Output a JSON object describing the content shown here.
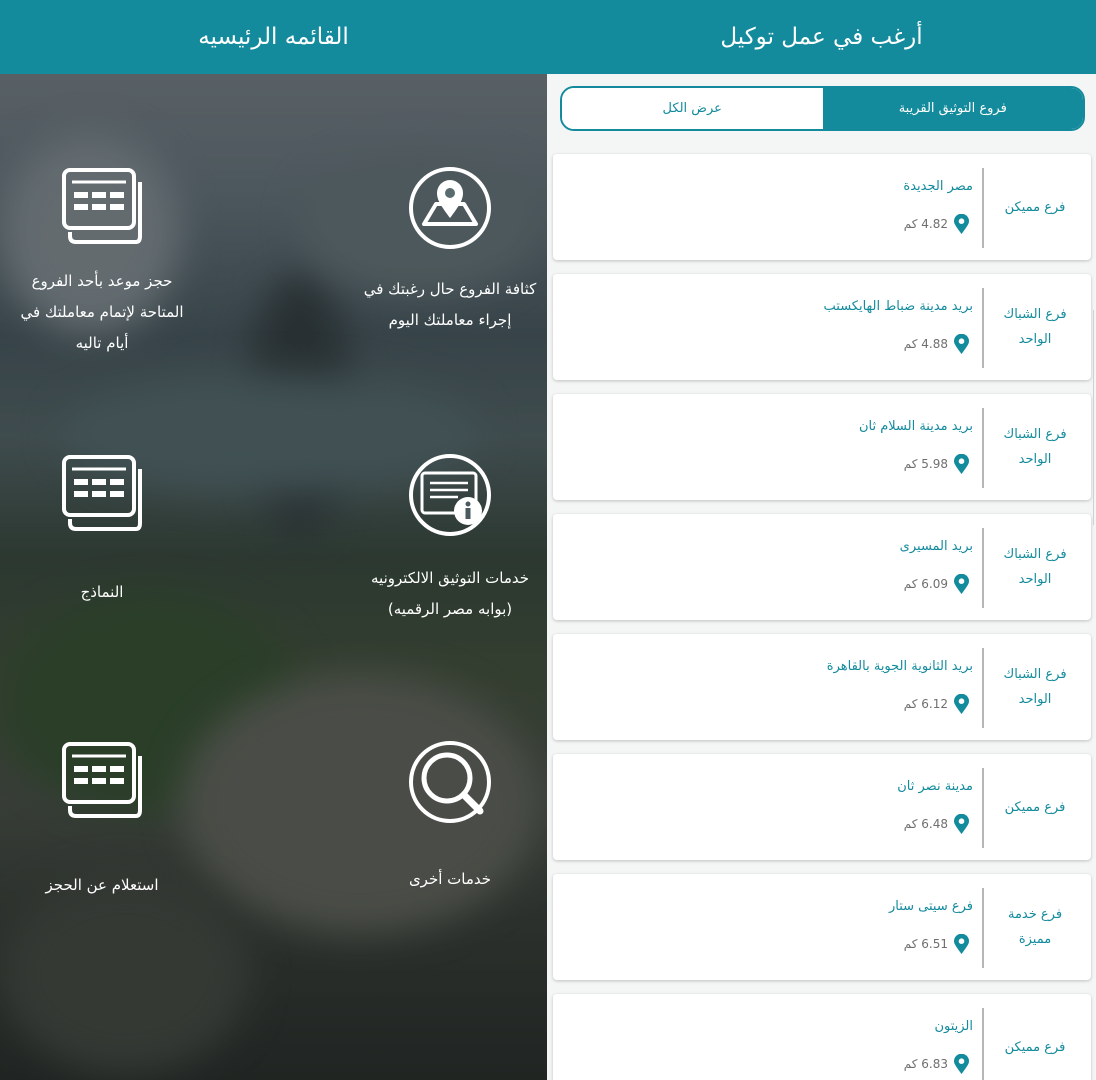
{
  "main_menu": {
    "title": "القائمه الرئيسيه",
    "items": [
      {
        "icon": "map-location-icon",
        "label_lines": [
          "كثافة الفروع حال رغبتك في",
          "إجراء معاملتك اليوم"
        ]
      },
      {
        "icon": "appointment-calendar-icon",
        "label_lines": [
          "حجز موعد بأحد الفروع",
          "المتاحة لإتمام معاملتك في",
          "أيام تاليه"
        ]
      },
      {
        "icon": "certificate-info-icon",
        "label_lines": [
          "خدمات التوثيق الالكترونيه",
          "(بوابه مصر الرقميه)"
        ]
      },
      {
        "icon": "forms-document-icon",
        "label_lines": [
          "النماذج"
        ]
      },
      {
        "icon": "search-icon",
        "label_lines": [
          "خدمات أخرى"
        ]
      },
      {
        "icon": "booking-inquiry-icon",
        "label_lines": [
          "استعلام عن الحجز"
        ]
      }
    ]
  },
  "delegation": {
    "title": "أرغب في عمل توكيل",
    "tabs": {
      "nearby": "فروع التوثيق القريبة",
      "all": "عرض الكل"
    },
    "active_tab": "nearby",
    "accent_color": "#138b9d",
    "branches": [
      {
        "type_lines": [
          "فرع مميكن"
        ],
        "name": "مصر الجديدة",
        "distance": "4.82 كم"
      },
      {
        "type_lines": [
          "فرع الشباك",
          "الواحد"
        ],
        "name": "بريد مدينة ضباط الهايكستب",
        "distance": "4.88 كم"
      },
      {
        "type_lines": [
          "فرع الشباك",
          "الواحد"
        ],
        "name": "بريد مدينة السلام ثان",
        "distance": "5.98 كم"
      },
      {
        "type_lines": [
          "فرع الشباك",
          "الواحد"
        ],
        "name": "بريد المسيرى",
        "distance": "6.09 كم"
      },
      {
        "type_lines": [
          "فرع الشباك",
          "الواحد"
        ],
        "name": "بريد الثانوية الجوية بالقاهرة",
        "distance": "6.12 كم"
      },
      {
        "type_lines": [
          "فرع مميكن"
        ],
        "name": "مدينة نصر ثان",
        "distance": "6.48 كم"
      },
      {
        "type_lines": [
          "فرع خدمة",
          "مميزة"
        ],
        "name": "فرع سيتى ستار",
        "distance": "6.51 كم"
      },
      {
        "type_lines": [
          "فرع مميكن"
        ],
        "name": "الزيتون",
        "distance": "6.83 كم"
      }
    ]
  }
}
